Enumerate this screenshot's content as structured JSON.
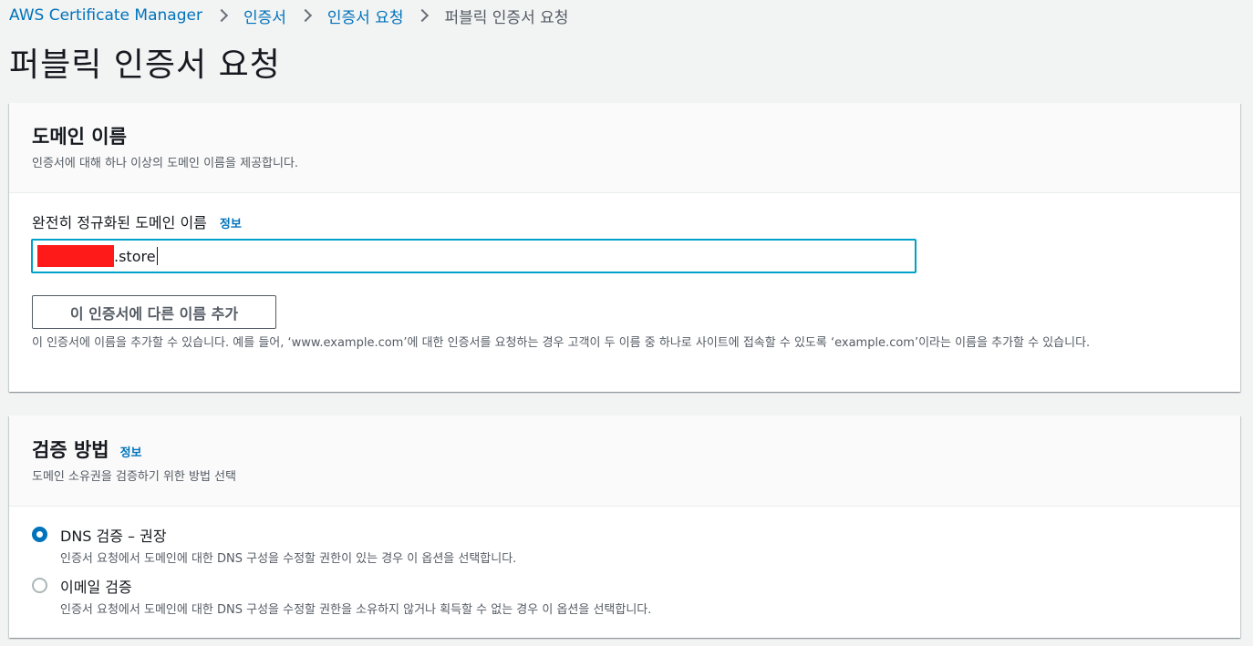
{
  "breadcrumb": {
    "items": [
      "AWS Certificate Manager",
      "인증서",
      "인증서 요청"
    ],
    "current": "퍼블릭 인증서 요청"
  },
  "page_title": "퍼블릭 인증서 요청",
  "domain_section": {
    "title": "도메인 이름",
    "description": "인증서에 대해 하나 이상의 도메인 이름을 제공합니다.",
    "field_label": "완전히 정규화된 도메인 이름",
    "info_label": "정보",
    "input_value_suffix": ".store",
    "add_button_label": "이 인증서에 다른 이름 추가",
    "help_text": "이 인증서에 이름을 추가할 수 있습니다. 예를 들어, ‘www.example.com’에 대한 인증서를 요청하는 경우 고객이 두 이름 중 하나로 사이트에 접속할 수 있도록 ‘example.com’이라는 이름을 추가할 수 있습니다."
  },
  "validation_section": {
    "title": "검증 방법",
    "info_label": "정보",
    "description": "도메인 소유권을 검증하기 위한 방법 선택",
    "options": [
      {
        "label": "DNS 검증 – 권장",
        "description": "인증서 요청에서 도메인에 대한 DNS 구성을 수정할 권한이 있는 경우 이 옵션을 선택합니다.",
        "selected": true
      },
      {
        "label": "이메일 검증",
        "description": "인증서 요청에서 도메인에 대한 DNS 구성을 수정할 권한을 소유하지 않거나 획득할 수 없는 경우 이 옵션을 선택합니다.",
        "selected": false
      }
    ]
  },
  "colors": {
    "link": "#0073bb",
    "focus_border": "#00a1c9",
    "redaction": "#ff1a1a",
    "background": "#f2f3f3"
  }
}
